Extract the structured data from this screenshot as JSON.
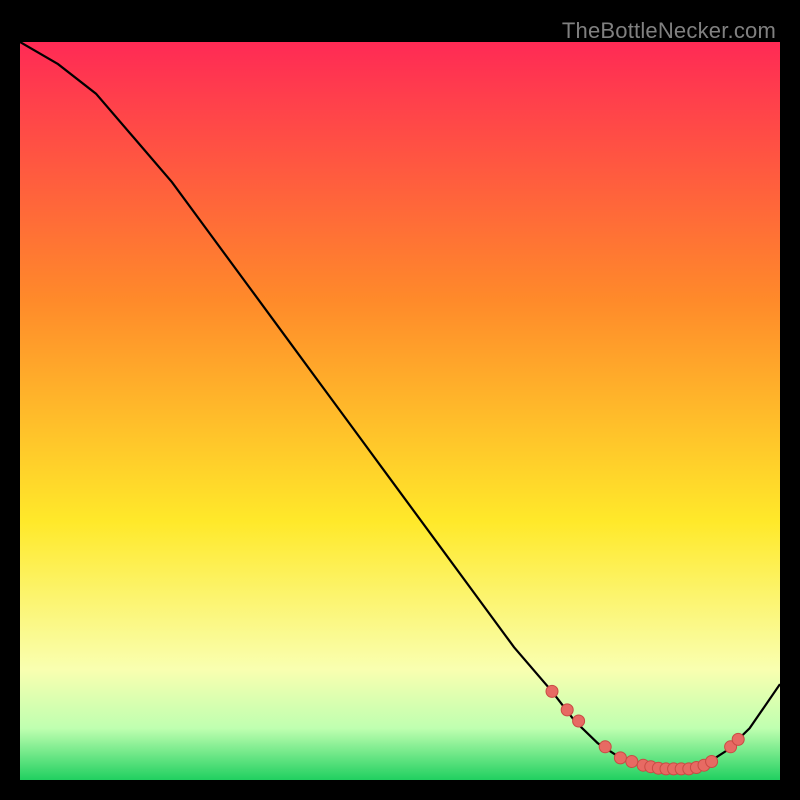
{
  "watermark": "TheBottleNecker.com",
  "colors": {
    "grad_top": "#ff2a55",
    "grad_mid1": "#ff8a2a",
    "grad_mid2": "#ffe92a",
    "grad_low1": "#f9ffb0",
    "grad_low2": "#bfffb0",
    "grad_bottom": "#20d060",
    "curve": "#000000",
    "marker_fill": "#e76a63",
    "marker_stroke": "#c94b44"
  },
  "chart_data": {
    "type": "line",
    "title": "",
    "xlabel": "",
    "ylabel": "",
    "xlim": [
      0,
      100
    ],
    "ylim": [
      0,
      100
    ],
    "series": [
      {
        "name": "curve",
        "x": [
          0,
          5,
          10,
          15,
          20,
          25,
          30,
          35,
          40,
          45,
          50,
          55,
          60,
          65,
          70,
          73,
          76,
          79,
          82,
          85,
          88,
          90,
          93,
          96,
          100
        ],
        "y": [
          100,
          97,
          93,
          87,
          81,
          74,
          67,
          60,
          53,
          46,
          39,
          32,
          25,
          18,
          12,
          8,
          5,
          3,
          2,
          1.5,
          1.5,
          2,
          4,
          7,
          13
        ]
      }
    ],
    "markers": {
      "name": "highlighted-points",
      "x": [
        70,
        72,
        73.5,
        77,
        79,
        80.5,
        82,
        83,
        84,
        85,
        86,
        87,
        88,
        89,
        90,
        91,
        93.5,
        94.5
      ],
      "y": [
        12,
        9.5,
        8,
        4.5,
        3,
        2.5,
        2,
        1.8,
        1.6,
        1.5,
        1.5,
        1.5,
        1.5,
        1.7,
        2,
        2.5,
        4.5,
        5.5
      ]
    }
  }
}
